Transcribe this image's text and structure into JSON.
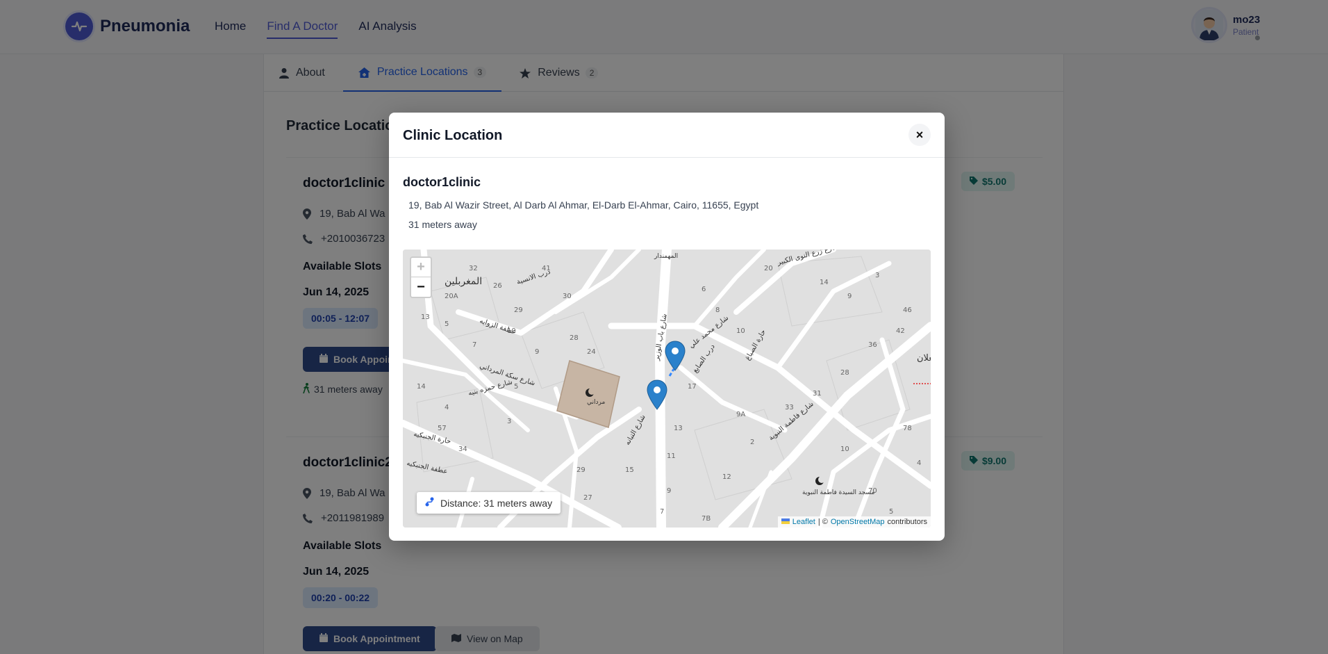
{
  "header": {
    "brand": "Pneumonia",
    "nav": [
      {
        "label": "Home",
        "active": false
      },
      {
        "label": "Find A Doctor",
        "active": true
      },
      {
        "label": "AI Analysis",
        "active": false
      }
    ],
    "user": {
      "name": "mo23",
      "role": "Patient"
    }
  },
  "tabs": [
    {
      "label": "About",
      "icon": "user-icon"
    },
    {
      "label": "Practice Locations",
      "count": "3",
      "icon": "clinic-icon"
    },
    {
      "label": "Reviews",
      "count": "2",
      "icon": "star-icon"
    }
  ],
  "section_title": "Practice Locations",
  "clinics": [
    {
      "name": "doctor1clinic",
      "address": "19, Bab Al Wa",
      "phone": "+2010036723",
      "price": "$5.00",
      "slots_label": "Available Slots",
      "date": "Jun 14, 2025",
      "slot": "00:05 - 12:07",
      "book_label": "Book Appointment",
      "distance": "31 meters away"
    },
    {
      "name": "doctor1clinic2",
      "address": "19, Bab Al Wa",
      "phone": "+2011981989",
      "price": "$9.00",
      "slots_label": "Available Slots",
      "date": "Jun 14, 2025",
      "slot": "00:20 - 00:22",
      "book_label": "Book Appointment",
      "map_label": "View on Map"
    }
  ],
  "modal": {
    "title": "Clinic Location",
    "close": "×",
    "clinic_name": "doctor1clinic",
    "address": "19, Bab Al Wazir Street, Al Darb Al Ahmar, El-Darb El-Ahmar, Cairo, 11655, Egypt",
    "distance": "31 meters away",
    "map": {
      "zoom_in": "+",
      "zoom_out": "−",
      "distance_label": "Distance: 31 meters away",
      "attribution_leaflet": "Leaflet",
      "attribution_sep": "| ©",
      "attribution_osm": "OpenStreetMap",
      "attribution_contrib": "contributors",
      "labels": {
        "district": "المغربلين",
        "mosque1": "مرداني",
        "mosque2": "مسجد السيدة فاطمة النبوية",
        "street1": "شارع سكة المرداني",
        "street2": "شارع باب الوزير",
        "street3": "شارع محمد علي",
        "street4": "شارع فاطمة النبوية",
        "street5": "شارع زرع النوى الكبير",
        "street6": "عطفة الزوايه",
        "street7": "شارع حمزه بنيه",
        "street8": "حارة الجنبكيه",
        "street9": "عطفة الجنبكيه",
        "street10": "شارع التبانه",
        "street11": "درب الصابغ",
        "street12": "حارة الصباغ",
        "street13": "المهمندار",
        "street14": "درب الانسية",
        "street15": "شعلان"
      }
    }
  },
  "colors": {
    "brand": "#4f5bd5",
    "accent": "#2563eb",
    "book_button": "#2f4a8a",
    "marker": "#2a81cb"
  }
}
